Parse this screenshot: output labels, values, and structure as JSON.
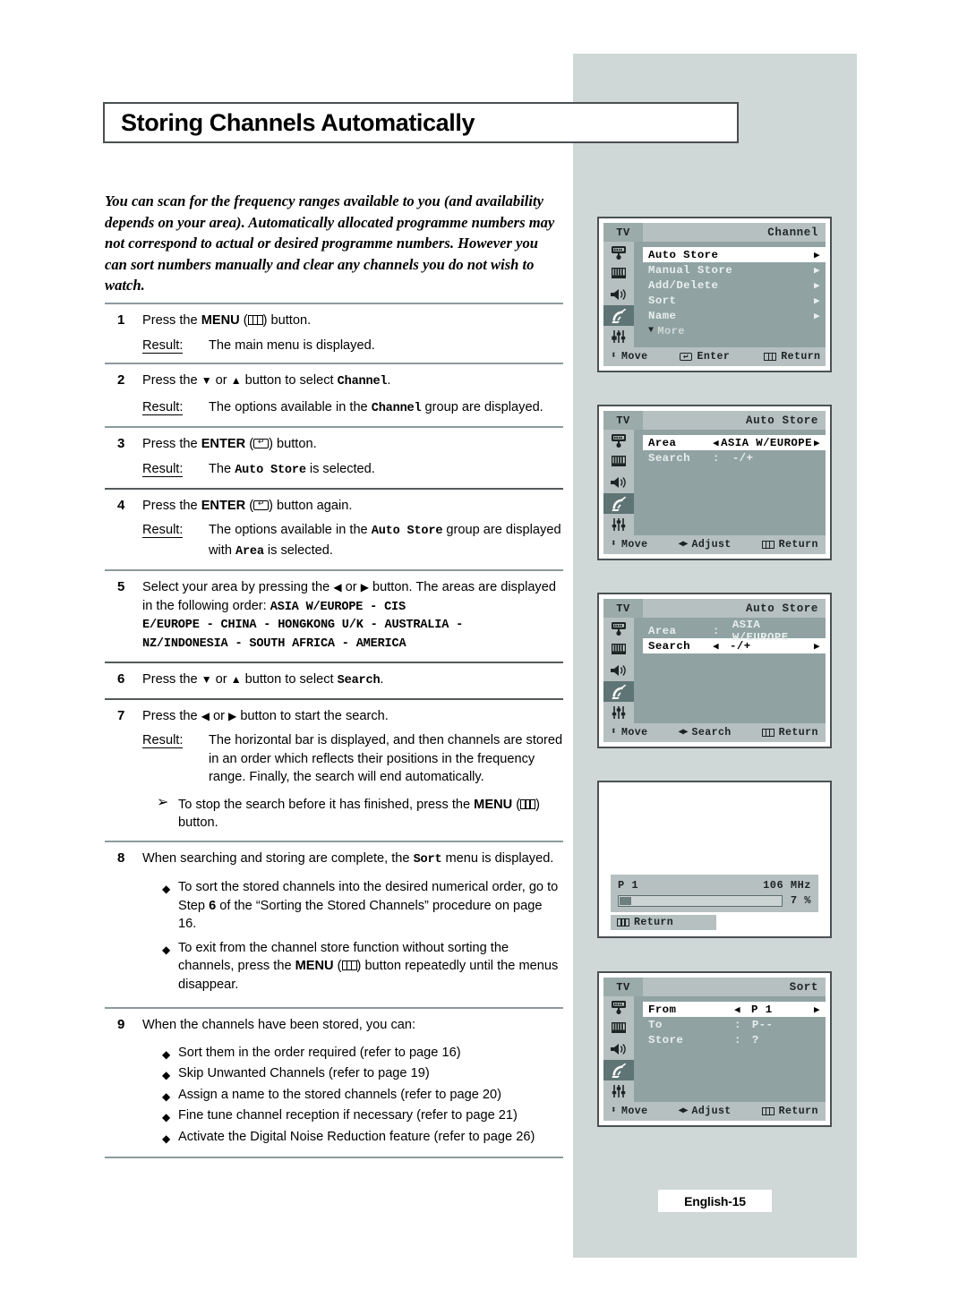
{
  "page": {
    "title": "Storing Channels Automatically",
    "footer_badge": "English-15",
    "intro": "You can scan for the frequency ranges available to you (and availability depends on your area). Automatically allocated programme numbers may not correspond to actual or desired programme numbers. However you can sort numbers manually and clear any channels you do not wish to watch.",
    "result_label": "Result:"
  },
  "steps": {
    "s1": {
      "num": "1",
      "pre": "Press the ",
      "bold": "MENU",
      "mid": " (",
      "post": ") button.",
      "result": "The main menu is displayed."
    },
    "s2": {
      "num": "2",
      "pre": "Press the ",
      "down": "▼",
      "or": " or ",
      "up": "▲",
      "mid": " button to select ",
      "mono": "Channel",
      "post": ".",
      "result_pre": "The options available in the ",
      "result_mono": "Channel",
      "result_post": " group are displayed."
    },
    "s3": {
      "num": "3",
      "pre": "Press the ",
      "bold": "ENTER",
      "mid": " (",
      "post": ") button.",
      "result_pre": "The ",
      "result_mono": "Auto Store",
      "result_post": " is selected."
    },
    "s4": {
      "num": "4",
      "pre": "Press the ",
      "bold": "ENTER",
      "mid": " (",
      "post": ") button again.",
      "result_pre": "The options available in the ",
      "result_mono": "Auto Store",
      "result_mid": " group are displayed with ",
      "result_mono2": "Area",
      "result_post": " is selected."
    },
    "s5": {
      "num": "5",
      "pre": "Select your area by pressing the ",
      "left": "◀",
      "or": " or ",
      "right": "▶",
      "post": " button. The areas are displayed in the following order: ",
      "areas_line1": "ASIA W/EUROPE - CIS",
      "areas_line2": "E/EUROPE - CHINA - HONGKONG U/K - AUSTRALIA -",
      "areas_line3": "NZ/INDONESIA - SOUTH AFRICA - AMERICA"
    },
    "s6": {
      "num": "6",
      "pre": "Press the ",
      "down": "▼",
      "or": " or ",
      "up": "▲",
      "mid": " button to select ",
      "mono": "Search",
      "post": "."
    },
    "s7": {
      "num": "7",
      "pre": "Press the ",
      "left": "◀",
      "or": " or ",
      "right": "▶",
      "post": " button to start the search.",
      "result": "The horizontal bar is displayed, and then channels are stored in an order which reflects their positions in the frequency range. Finally, the search will end automatically.",
      "note_mark": "➢",
      "note_pre": "To stop the search before it has finished, press the ",
      "note_bold": "MENU",
      "note_mid": " (",
      "note_post": ") button."
    },
    "s8": {
      "num": "8",
      "pre": "When searching and storing are complete, the ",
      "mono": "Sort",
      "post": " menu is displayed.",
      "bullets": [
        "To sort the stored channels into the desired numerical order, go to Step 6 of the “Sorting the Stored Channels” procedure on page 16.",
        "To exit from the channel store function without sorting the channels, press the MENU (▥) button repeatedly until the menus disappear."
      ],
      "bullet1_pre": "To sort the stored channels into the desired numerical order, go to Step ",
      "bullet1_bold": "6",
      "bullet1_post": " of the “Sorting the Stored Channels” procedure on page 16.",
      "bullet2_pre": "To exit from the channel store function without sorting the channels, press the ",
      "bullet2_bold": "MENU",
      "bullet2_mid": " (",
      "bullet2_post": ") button repeatedly until the menus disappear."
    },
    "s9": {
      "num": "9",
      "text": "When the channels have been stored, you can:",
      "bullets": [
        "Sort them in the order required (refer to page 16)",
        "Skip Unwanted Channels (refer to page 19)",
        "Assign a name to the stored channels (refer to page 20)",
        "Fine tune channel reception if necessary (refer to page 21)",
        "Activate the Digital Noise Reduction feature (refer to page 26)"
      ]
    }
  },
  "osd": {
    "tv_label": "TV",
    "panel1": {
      "title": "Channel",
      "rows": [
        {
          "label": "Auto Store",
          "caret": "▶",
          "selected": true
        },
        {
          "label": "Manual Store",
          "caret": "▶",
          "selected": false
        },
        {
          "label": "Add/Delete",
          "caret": "▶",
          "selected": false
        },
        {
          "label": "Sort",
          "caret": "▶",
          "selected": false
        },
        {
          "label": "Name",
          "caret": "▶",
          "selected": false
        }
      ],
      "more": "More",
      "more_tri": "▼",
      "footer": {
        "move": "Move",
        "enter": "Enter",
        "return": "Return"
      }
    },
    "panel2": {
      "title": "Auto Store",
      "row1": {
        "label": "Area",
        "caret_l": "◀",
        "value": "ASIA W/EUROPE",
        "caret_r": "▶",
        "selected": true
      },
      "row2": {
        "label": "Search",
        "sep": ":",
        "value": "-/+",
        "selected": false
      },
      "footer": {
        "move": "Move",
        "adjust": "Adjust",
        "return": "Return"
      }
    },
    "panel3": {
      "title": "Auto Store",
      "row1": {
        "label": "Area",
        "sep": ":",
        "value": "ASIA W/EUROPE",
        "selected": false
      },
      "row2": {
        "label": "Search",
        "caret_l": "◀",
        "value": "-/+",
        "caret_r": "▶",
        "selected": true
      },
      "footer": {
        "move": "Move",
        "search": "Search",
        "return": "Return"
      }
    },
    "panel4": {
      "programme": "P 1",
      "frequency": "106 MHz",
      "percent": "7 %",
      "progress_value": 7,
      "return": "Return"
    },
    "panel5": {
      "title": "Sort",
      "row1": {
        "label": "From",
        "caret_l": "◀",
        "value": "P 1",
        "caret_r": "▶",
        "selected": true
      },
      "row2": {
        "label": "To",
        "sep": ":",
        "value": "P--",
        "selected": false
      },
      "row3": {
        "label": "Store",
        "sep": ":",
        "value": "?",
        "selected": false
      },
      "footer": {
        "move": "Move",
        "adjust": "Adjust",
        "return": "Return"
      }
    },
    "icons": [
      "picture-icon",
      "picture-bars-icon",
      "speaker-icon",
      "satellite-dish-icon",
      "setup-sliders-icon"
    ]
  },
  "colors": {
    "gray_column": "#cfd8d6",
    "osd_body": "#90a3a2",
    "osd_chrome": "#b6c0c0",
    "osd_selected_icon": "#5f7474",
    "rule": "#8d9a9e"
  }
}
